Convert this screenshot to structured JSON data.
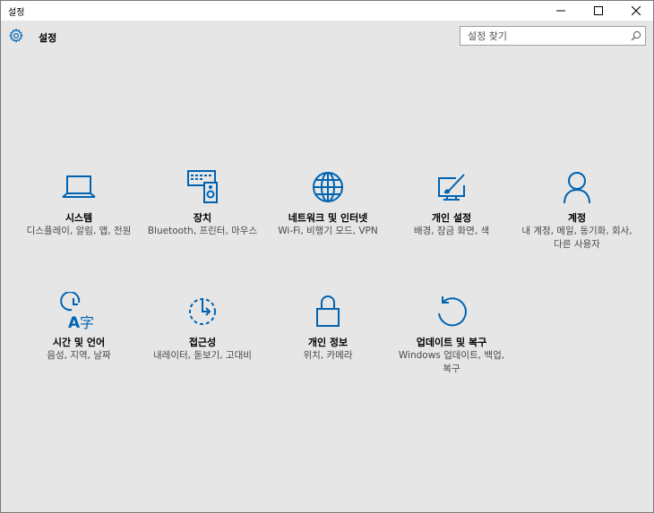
{
  "window": {
    "title": "설정"
  },
  "header": {
    "title": "설정"
  },
  "search": {
    "placeholder": "설정 찾기"
  },
  "accent": "#0063b1",
  "tiles": [
    {
      "icon": "laptop-icon",
      "label": "시스템",
      "desc": "디스플레이, 알림, 앱, 전원"
    },
    {
      "icon": "devices-icon",
      "label": "장치",
      "desc": "Bluetooth, 프린터, 마우스"
    },
    {
      "icon": "globe-icon",
      "label": "네트워크 및 인터넷",
      "desc": "Wi-Fi, 비행기 모드, VPN"
    },
    {
      "icon": "personalization-icon",
      "label": "개인 설정",
      "desc": "배경, 잠금 화면, 색"
    },
    {
      "icon": "person-icon",
      "label": "계정",
      "desc": "내 계정, 메일, 동기화, 회사, 다른 사용자"
    },
    {
      "icon": "time-language-icon",
      "label": "시간 및 언어",
      "desc": "음성, 지역, 날짜"
    },
    {
      "icon": "ease-of-access-icon",
      "label": "접근성",
      "desc": "내레이터, 돋보기, 고대비"
    },
    {
      "icon": "lock-icon",
      "label": "개인 정보",
      "desc": "위치, 카메라"
    },
    {
      "icon": "update-icon",
      "label": "업데이트 및 복구",
      "desc": "Windows 업데이트, 백업, 복구"
    }
  ]
}
